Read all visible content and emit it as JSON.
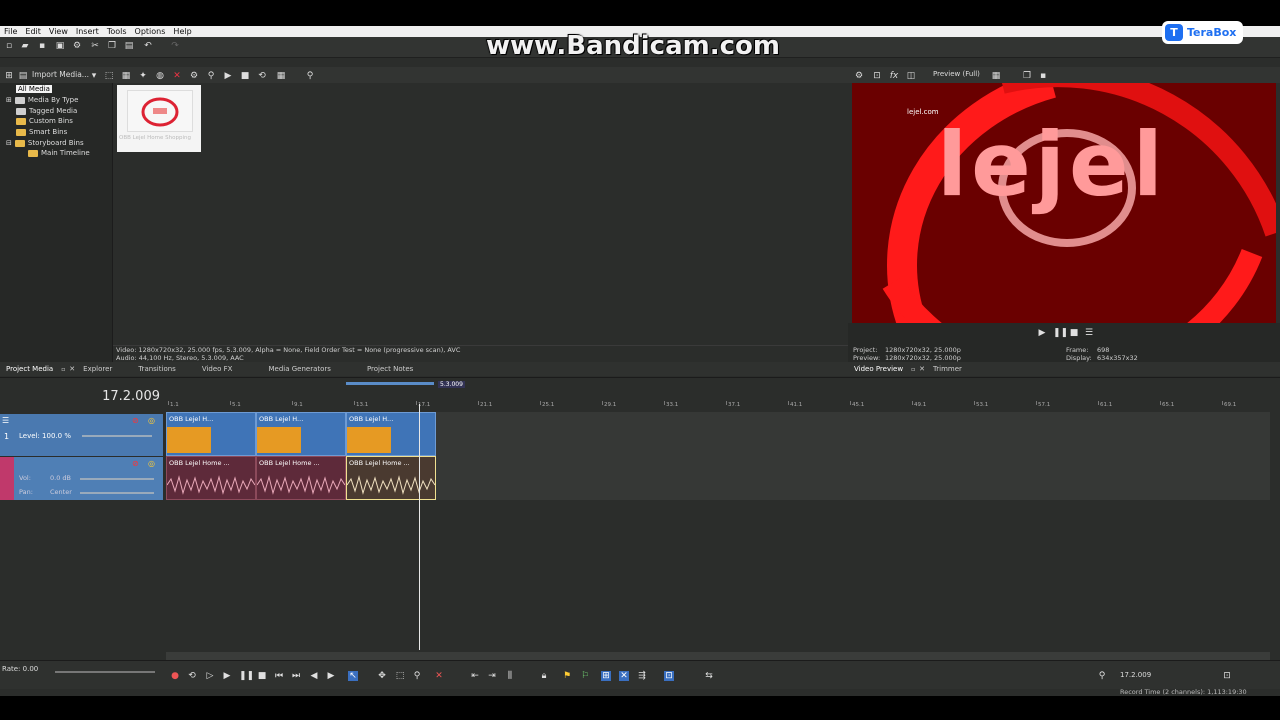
{
  "watermark": "www.Bandicam.com",
  "terabox": {
    "label": "TeraBox"
  },
  "menu": [
    "File",
    "Edit",
    "View",
    "Insert",
    "Tools",
    "Options",
    "Help"
  ],
  "project_media": {
    "import_label": "Import Media...",
    "tree": [
      "All Media",
      "Media By Type",
      "Tagged Media",
      "Custom Bins",
      "Smart Bins",
      "Storyboard Bins",
      "Main Timeline"
    ],
    "thumb_caption": "OBB Lejel Home Shopping",
    "info_video": "Video: 1280x720x32, 25.000 fps, 5.3.009, Alpha = None, Field Order Test = None (progressive scan), AVC",
    "info_audio": "Audio: 44,100 Hz, Stereo, 5.3.009, AAC"
  },
  "tabs_left": [
    "Project Media",
    "Explorer",
    "Transitions",
    "Video FX",
    "Media Generators",
    "Project Notes"
  ],
  "preview": {
    "mode": "Preview (Full)",
    "overlay_url": "lejel.com",
    "logo_text": "lejel",
    "project_label": "Project:",
    "project_value": "1280x720x32, 25.000p",
    "preview_label": "Preview:",
    "preview_value": "1280x720x32, 25.000p",
    "frame_label": "Frame:",
    "frame_value": "698",
    "display_label": "Display:",
    "display_value": "634x357x32",
    "tabs": [
      "Video Preview",
      "Trimmer"
    ],
    "colors": {
      "bg": "#5a0000",
      "ring": "#ff1a1a",
      "text": "#ff9a9a"
    }
  },
  "timeline": {
    "timecode": "17.2.009",
    "selection_label": "5.3.009",
    "ruler_labels": [
      "1.1",
      "5.1",
      "9.1",
      "13.1",
      "17.1",
      "21.1",
      "25.1",
      "29.1",
      "33.1",
      "37.1",
      "41.1",
      "45.1",
      "49.1",
      "53.1",
      "57.1",
      "61.1",
      "65.1",
      "69.1"
    ],
    "video_track": {
      "number": "1",
      "level_label": "Level: 100.0 %"
    },
    "audio_track": {
      "number": "2",
      "vol_label": "Vol:",
      "vol_value": "0.0 dB",
      "pan_label": "Pan:",
      "pan_value": "Center"
    },
    "video_clips": [
      "OBB Lejel H...",
      "OBB Lejel H...",
      "OBB Lejel H..."
    ],
    "audio_clips": [
      "OBB Lejel Home ...",
      "OBB Lejel Home ...",
      "OBB Lejel Home ..."
    ]
  },
  "transport": {
    "rate_label": "Rate: 0.00",
    "time_right": "17.2.009",
    "record_time": "Record Time (2 channels): 1,113:19:30"
  }
}
